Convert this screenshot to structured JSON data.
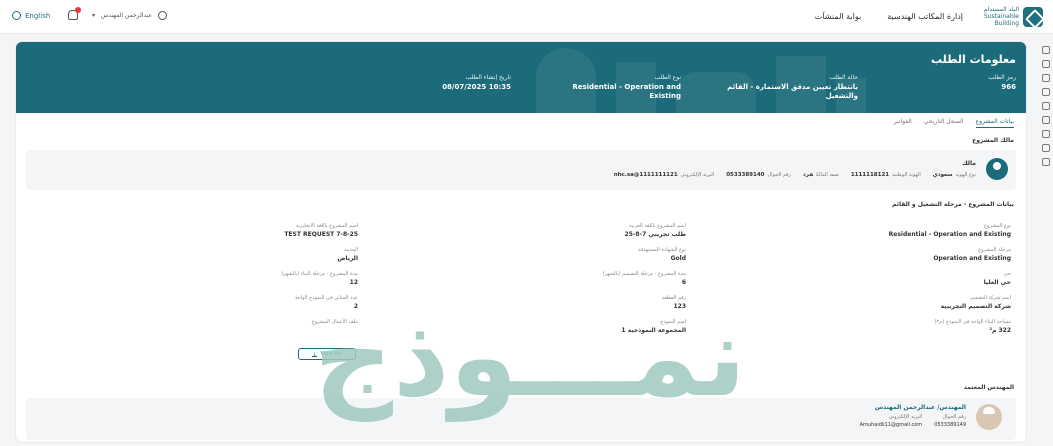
{
  "topbar": {
    "logo_text": "البلد المستدام Sustainable Building",
    "nav": [
      "إدارة المكاتب الهندسية",
      "بوابة المنشآت"
    ],
    "language": "English",
    "user_name": "عبدالرحمن المهندس"
  },
  "hero": {
    "title": "معلومات الطلب",
    "fields": [
      {
        "label": "رمز الطلب",
        "value": "966"
      },
      {
        "label": "حالة الطلب",
        "value": "بانتظار تعيين مدقق الاستمارة - القائم والتشغيل"
      },
      {
        "label": "نوع الطلب",
        "value": "Residential - Operation and Existing"
      },
      {
        "label": "تاريخ إنشاء الطلب",
        "value": "10:35 08/07/2025"
      }
    ]
  },
  "tabs": [
    "بيانات المشروع",
    "السجل التاريخي",
    "الفواتير"
  ],
  "owner": {
    "section": "مالك المشروع",
    "name": "مالك",
    "items": [
      {
        "label": "نوع الهوية",
        "value": "سعودي"
      },
      {
        "label": "الهوية الوطنية",
        "value": "1111118121"
      },
      {
        "label": "صفة المالك",
        "value": "فرد"
      },
      {
        "label": "رقم الجوال",
        "value": "0533389140"
      },
      {
        "label": "البريد الإلكتروني",
        "value": "nhc.sa@1111111121"
      }
    ]
  },
  "project": {
    "section": "بيانات المشروع - مرحلة التشغيل و القائم",
    "col_right": [
      {
        "label": "نوع المشروع",
        "value": "Residential - Operation and Existing"
      },
      {
        "label": "مرحلة المشروع",
        "value": "Operation and Existing"
      },
      {
        "label": "حي",
        "value": "حي العليا"
      },
      {
        "label": "اسم شركة التصميم",
        "value": "شركة التصميم التجريبية"
      },
      {
        "label": "مساحة البناء الواحد في النموذج (م٢)",
        "value": "322 م²"
      }
    ],
    "col_mid": [
      {
        "label": "اسم المشروع باللغة العربية",
        "value": "طلب تجريبي 7-8-25"
      },
      {
        "label": "نوع الشهادة المستهدفة",
        "value": "Gold"
      },
      {
        "label": "مدة المشروع - مرحلة التصميم (بالشهر)",
        "value": "6"
      },
      {
        "label": "رقم القطعة",
        "value": "123"
      },
      {
        "label": "اسم النموذج",
        "value": "المجموعة النموذجية 1"
      }
    ],
    "col_left": [
      {
        "label": "اسم المشروع باللغة الانجليزية",
        "value": "TEST REQUEST 7-8-25"
      },
      {
        "label": "المدينة",
        "value": "الرياض"
      },
      {
        "label": "مدة المشروع - مرحلة البناء (بالشهر)",
        "value": "12"
      },
      {
        "label": "عدد المباني في النموذج الواحد",
        "value": "2"
      },
      {
        "label": "ملف الأعمال المشروع",
        "value": ""
      }
    ],
    "view_file": "View file"
  },
  "engineer": {
    "section": "المهندس المعتمد",
    "name": "المهندس/ عبدالرحمن المهندس",
    "items": [
      {
        "label": "رقم الجوال",
        "value": "0533389149"
      },
      {
        "label": "البريد الإلكتروني",
        "value": "Amuhaidli11@gmail.com"
      }
    ]
  },
  "watermark": "نمـــوذج",
  "colors": {
    "primary": "#1b6b7a",
    "watermark": "#9fc9bf"
  }
}
